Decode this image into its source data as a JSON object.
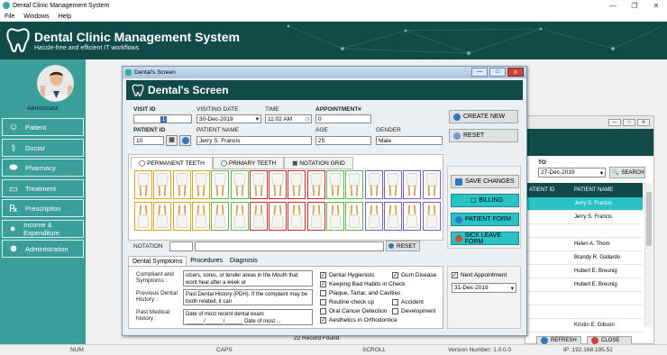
{
  "app": {
    "title": "Dental Clinic Management System",
    "menu": [
      "File",
      "Windows",
      "Help"
    ]
  },
  "banner": {
    "title": "Dental Clinic Management System",
    "subtitle": "Hassle-free and efficient IT workflows"
  },
  "sidebar": {
    "role": "Administrator",
    "items": [
      {
        "label": "Patient",
        "icon": "patient-icon"
      },
      {
        "label": "Doctor",
        "icon": "doctor-icon"
      },
      {
        "label": "Pharmacy",
        "icon": "pills-icon"
      },
      {
        "label": "Treatment",
        "icon": "tooth-icon"
      },
      {
        "label": "Prescription",
        "icon": "rx-icon"
      },
      {
        "label": "Income & Expenditure",
        "icon": "coins-icon"
      },
      {
        "label": "Administration",
        "icon": "people-icon"
      }
    ]
  },
  "statusbar": {
    "num": "NUM",
    "caps": "CAPS",
    "scroll": "SCROLL",
    "version": "Version Number: 1.0.0.0",
    "ip": "IP :192.168.195.51"
  },
  "bgwindow": {
    "to_label": "TO",
    "to_date": "27-Dec-2019",
    "search": "SEARCH",
    "columns": [
      "ATIENT ID",
      "PATIENT NAME"
    ],
    "rows": [
      "Jerry S. Francis",
      "Jerry S. Francis",
      "",
      "Helen A. Thom",
      "Brandy R. Gallardo",
      "Hubert E. Breunig",
      "Hubert E. Breunig",
      "",
      "",
      "Kristin E. Gibson"
    ],
    "records": "22 Record Found.",
    "refresh": "REFRESH",
    "close": "CLOSE"
  },
  "dialog": {
    "window_title": "Dental's Screen",
    "heading": "Dental's Screen",
    "visit_id_label": "VISIT ID",
    "visit_id": "1",
    "visiting_date_label": "VISITING DATE",
    "visiting_date": "30-Dec-2019",
    "time_label": "TIME",
    "time": "11:02 AM",
    "appointment_label": "APPOINTMENT#",
    "appointment": "0",
    "patient_id_label": "PATIENT ID",
    "patient_id": "10",
    "patient_name_label": "PATIENT NAME",
    "patient_name": "Jerry S. Francis",
    "age_label": "AGE",
    "age": "25",
    "gender_label": "GENDER",
    "gender": "Male",
    "create_new": "CREATE NEW",
    "reset": "RESET",
    "tabs": [
      "PERMANENT TEETH",
      "PRIMARY TEETH",
      "NOTATION GRID"
    ],
    "notation_label": "NOTATION",
    "notation_reset": "RESET",
    "save_changes": "SAVE CHANGES",
    "billing": "BILLING",
    "patient_form": "PATIENT FORM",
    "sick_leave": "SICK LEAVE FORM",
    "bottom_tabs": [
      "Dental Symptoms",
      "Procedures",
      "Diagnosis"
    ],
    "compliant_label": "Compliant and Symptoms :",
    "compliant_text": "ulcers, sores, or tender areas in the Mouth that wont heal after a week or",
    "prev_history_label": "Previous Dental History :",
    "prev_history_text": "Past Dental History (PDH). If the complaint may be tooth related, it can",
    "past_medical_label": "Past Medical history :",
    "past_medical_text": "Date of most recent dental exam ______/______/______ Date of most ...",
    "checks": [
      {
        "label": "Dental Hygienists",
        "checked": true
      },
      {
        "label": "Gum Disease",
        "checked": true
      },
      {
        "label": "Keeping Bad Habits in Check",
        "checked": true
      },
      {
        "label": "Plaque, Tartar, and Cavities",
        "checked": false
      },
      {
        "label": "Routine check up",
        "checked": false
      },
      {
        "label": "Accident",
        "checked": false
      },
      {
        "label": "Oral Cancer Detection",
        "checked": false
      },
      {
        "label": "Development",
        "checked": false
      },
      {
        "label": "Aesthetics in Orthodontice",
        "checked": true
      }
    ],
    "next_appointment_label": "Next Appointment",
    "next_appointment_checked": true,
    "next_appointment_date": "31-Dec-2019"
  },
  "colors": {
    "teal_dark": "#124a4a",
    "sidebar": "#3a9e9b",
    "accent": "#29c3c7"
  },
  "tooth_borders": [
    "#e0a020",
    "#e0a020",
    "#e0a020",
    "#e0a020",
    "#58b84a",
    "#58b84a",
    "#c03030",
    "#c03030",
    "#c03030",
    "#c03030",
    "#58b84a",
    "#58b84a",
    "#7a5ac0",
    "#7a5ac0",
    "#7a5ac0",
    "#7a5ac0"
  ]
}
